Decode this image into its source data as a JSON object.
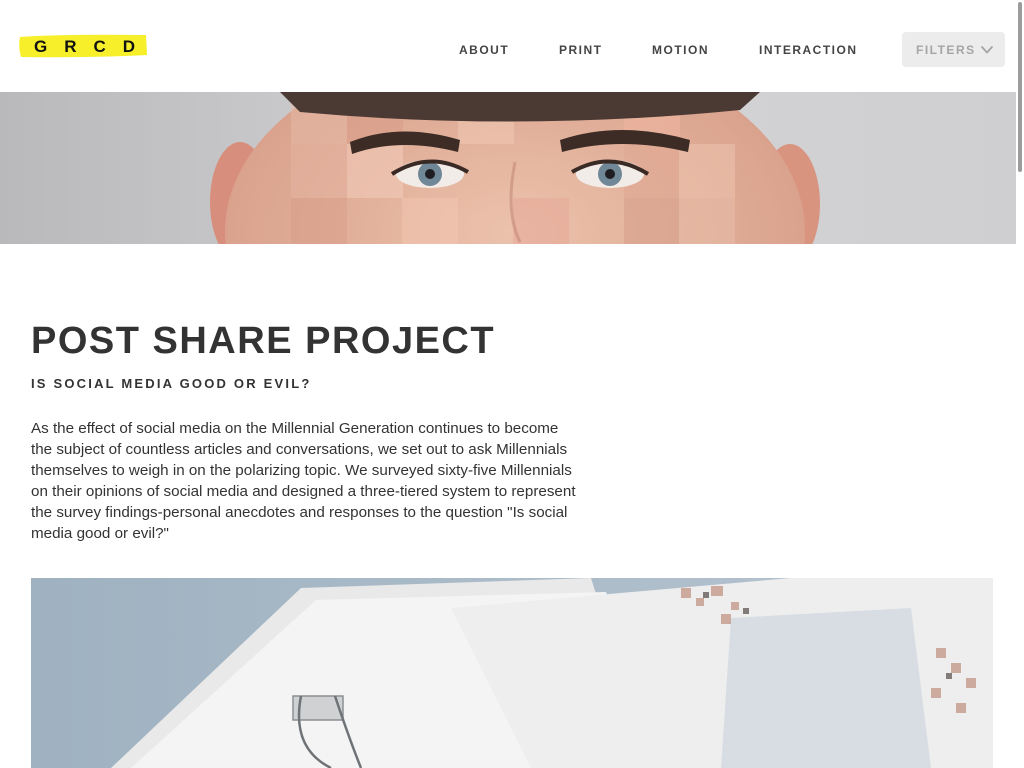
{
  "header": {
    "logo_text": "GRCD",
    "logo_color": "#f7ef2a",
    "nav": [
      {
        "label": "ABOUT"
      },
      {
        "label": "PRINT"
      },
      {
        "label": "MOTION"
      },
      {
        "label": "INTERACTION"
      }
    ],
    "filters_label": "FILTERS",
    "filters_icon": "chevron-down-icon"
  },
  "hero": {
    "icon": "face-mosaic-image"
  },
  "article": {
    "title": "POST SHARE PROJECT",
    "subtitle": "IS SOCIAL MEDIA GOOD OR EVIL?",
    "body": "As the effect of social media on the Millennial Generation continues to become the subject of countless articles and conversations, we set out to ask Millennials themselves to weigh in on the polarizing topic. We surveyed sixty-five Millennials on their opinions of social media and designed a three-tiered system to represent the survey findings-personal anecdotes and responses to the question \"Is social media good or evil?\""
  },
  "photo": {
    "icon": "paper-stack-binder-clip-image"
  }
}
